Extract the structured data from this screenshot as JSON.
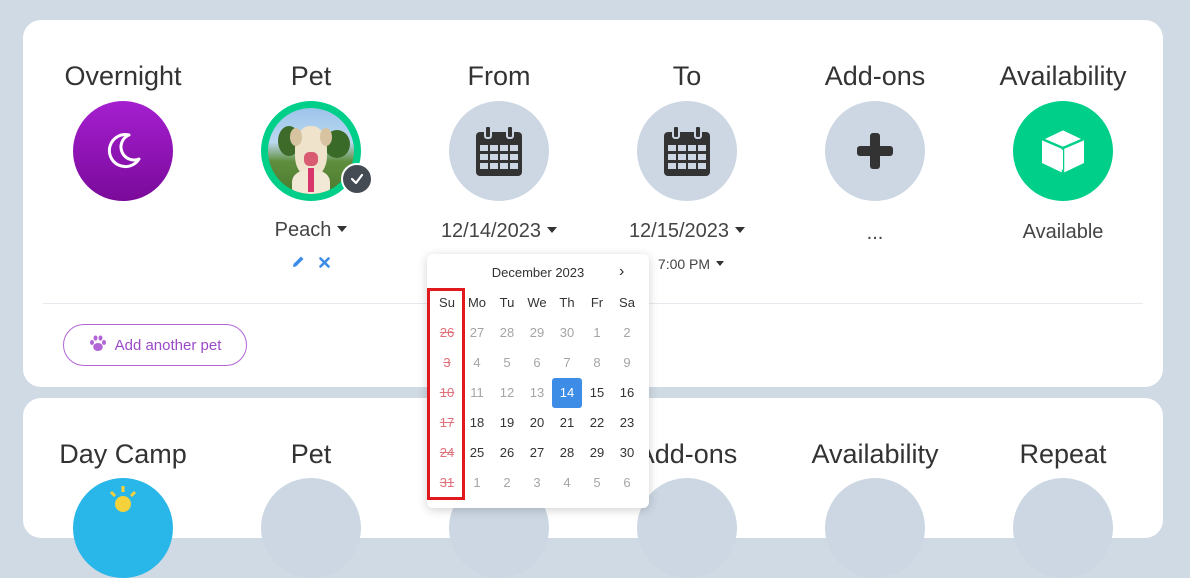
{
  "card1": {
    "columns": [
      {
        "title": "Overnight",
        "icon": "moon-icon"
      },
      {
        "title": "Pet",
        "icon": "pet-photo",
        "value": "Peach"
      },
      {
        "title": "From",
        "icon": "calendar-icon",
        "value": "12/14/2023"
      },
      {
        "title": "To",
        "icon": "calendar-icon",
        "value": "12/15/2023",
        "time": "7:00 PM"
      },
      {
        "title": "Add-ons",
        "icon": "plus-icon",
        "value": "..."
      },
      {
        "title": "Availability",
        "icon": "box-icon",
        "value": "Available"
      }
    ],
    "add_pet_label": "Add another pet"
  },
  "card2": {
    "columns": [
      {
        "title": "Day Camp"
      },
      {
        "title": "Pet"
      },
      {
        "title": "Add-ons"
      },
      {
        "title": "Availability"
      },
      {
        "title": "Repeat"
      }
    ]
  },
  "calendar": {
    "month_label": "December 2023",
    "next_icon": "›",
    "weekdays": [
      "Su",
      "Mo",
      "Tu",
      "We",
      "Th",
      "Fr",
      "Sa"
    ],
    "weeks": [
      [
        "26",
        "27",
        "28",
        "29",
        "30",
        "1",
        "2"
      ],
      [
        "3",
        "4",
        "5",
        "6",
        "7",
        "8",
        "9"
      ],
      [
        "10",
        "11",
        "12",
        "13",
        "14",
        "15",
        "16"
      ],
      [
        "17",
        "18",
        "19",
        "20",
        "21",
        "22",
        "23"
      ],
      [
        "24",
        "25",
        "26",
        "27",
        "28",
        "29",
        "30"
      ],
      [
        "31",
        "1",
        "2",
        "3",
        "4",
        "5",
        "6"
      ]
    ],
    "selected": "14"
  },
  "colors": {
    "accent_purple": "#9b4ac9",
    "available_green": "#00cf8a",
    "selected_blue": "#3d8ce6",
    "highlight_red": "#e0191f"
  }
}
